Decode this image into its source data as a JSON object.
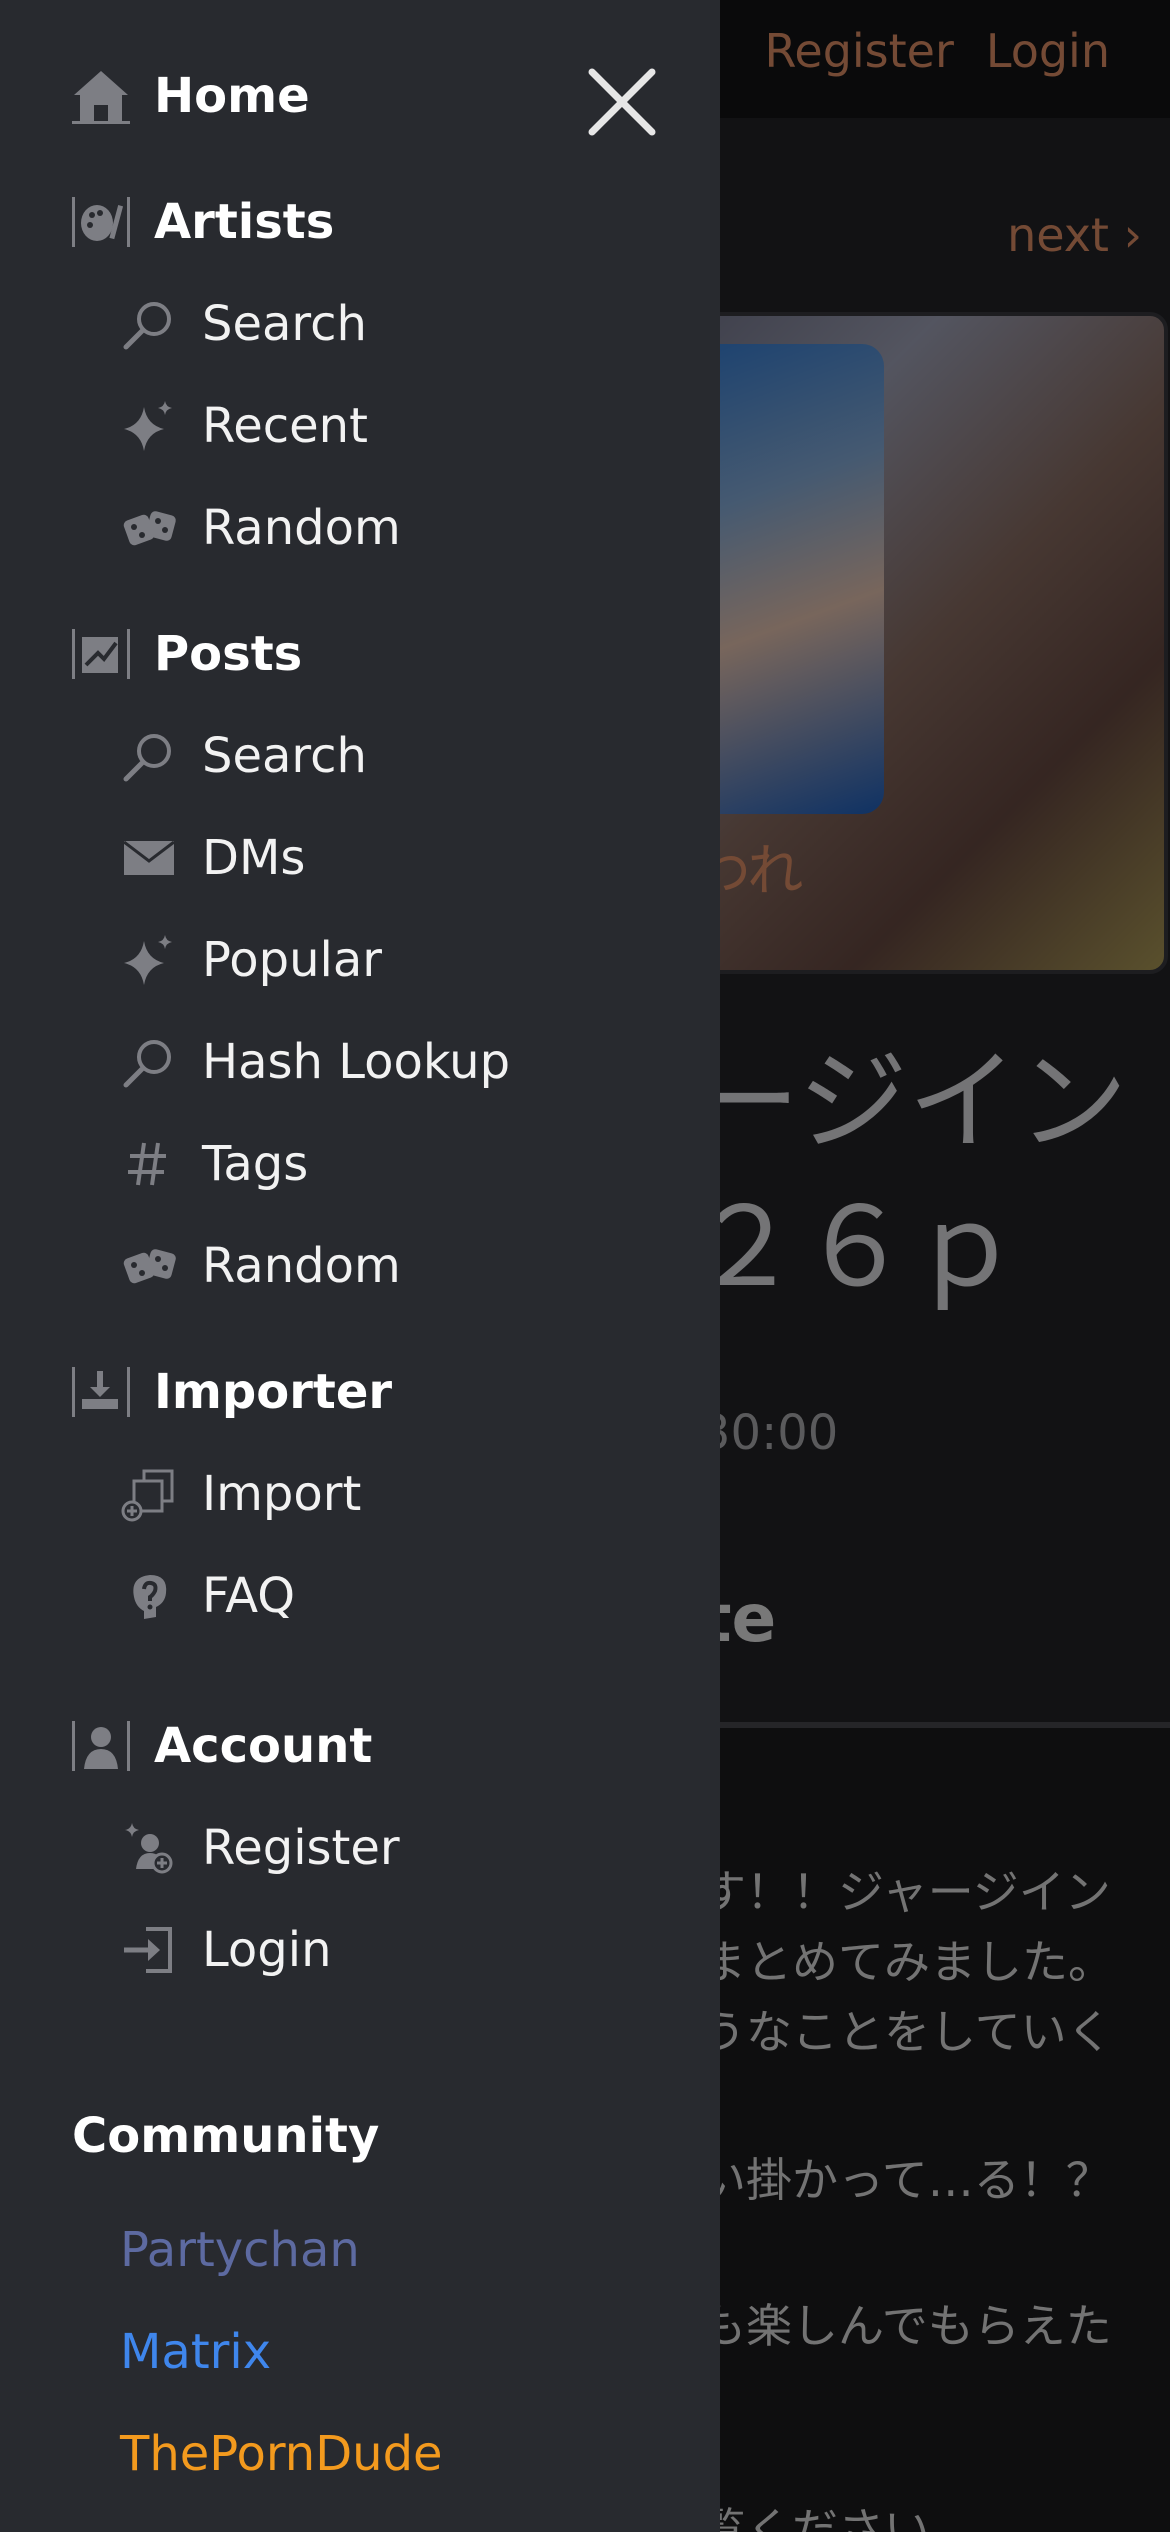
{
  "background_page": {
    "topnav": [
      "Register",
      "Login"
    ],
    "pager_next": "next ›",
    "art_caption": "われ",
    "title_line1": "ージイン",
    "title_line2": "２６ｐ",
    "time_fragment": "30:00",
    "note_fragment": "te",
    "body_lines": [
      "す！！ジャージイン",
      "まとめてみました。",
      "うなことをしていく",
      "",
      "い掛かって…る！？",
      "",
      "も楽しんでもらえた",
      "",
      "覧ください"
    ]
  },
  "drawer": {
    "sections": [
      {
        "label": "Home",
        "icon": "home-icon",
        "items": []
      },
      {
        "label": "Artists",
        "icon": "artists-icon",
        "items": [
          {
            "label": "Search",
            "icon": "search-icon"
          },
          {
            "label": "Recent",
            "icon": "sparkle-icon"
          },
          {
            "label": "Random",
            "icon": "dice-icon"
          }
        ]
      },
      {
        "label": "Posts",
        "icon": "posts-icon",
        "items": [
          {
            "label": "Search",
            "icon": "search-icon"
          },
          {
            "label": "DMs",
            "icon": "envelope-icon"
          },
          {
            "label": "Popular",
            "icon": "sparkle-icon"
          },
          {
            "label": "Hash Lookup",
            "icon": "search-icon"
          },
          {
            "label": "Tags",
            "icon": "hash-icon"
          },
          {
            "label": "Random",
            "icon": "dice-icon"
          }
        ]
      },
      {
        "label": "Importer",
        "icon": "importer-icon",
        "items": [
          {
            "label": "Import",
            "icon": "import-icon"
          },
          {
            "label": "FAQ",
            "icon": "faq-icon"
          }
        ]
      },
      {
        "label": "Account",
        "icon": "account-icon",
        "items": [
          {
            "label": "Register",
            "icon": "register-icon"
          },
          {
            "label": "Login",
            "icon": "login-icon"
          }
        ]
      }
    ],
    "community": {
      "title": "Community",
      "links": [
        {
          "label": "Partychan",
          "color": "#5d6aa1"
        },
        {
          "label": "Matrix",
          "color": "#3f86ec"
        },
        {
          "label": "ThePornDude",
          "color": "#f39a1e"
        }
      ]
    }
  }
}
